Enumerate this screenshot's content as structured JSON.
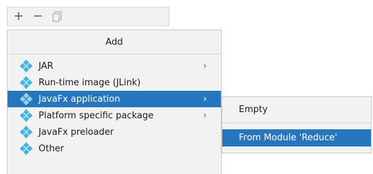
{
  "toolbar": {
    "add_icon": "+",
    "remove_icon": "−",
    "copy_icon": "copy-icon"
  },
  "menu": {
    "header": "Add",
    "items": [
      {
        "label": "JAR",
        "has_submenu": true
      },
      {
        "label": "Run-time image (JLink)",
        "has_submenu": false
      },
      {
        "label": "JavaFx application",
        "has_submenu": true,
        "selected": true
      },
      {
        "label": "Platform specific package",
        "has_submenu": true
      },
      {
        "label": "JavaFx preloader",
        "has_submenu": false
      },
      {
        "label": "Other",
        "has_submenu": false
      }
    ],
    "chevron": "›"
  },
  "submenu": {
    "items": [
      {
        "label": "Empty"
      },
      {
        "label": "From Module 'Reduce'",
        "selected": true
      }
    ]
  },
  "colors": {
    "selection": "#2675bf",
    "icon": "#40b6e0",
    "panel": "#f2f2f2"
  }
}
